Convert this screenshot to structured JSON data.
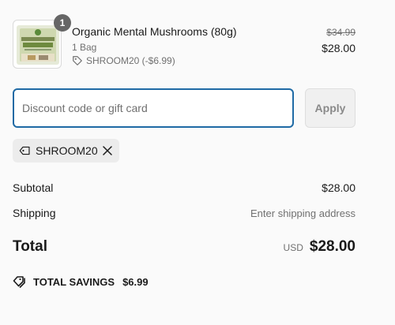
{
  "item": {
    "quantity": "1",
    "name": "Organic Mental Mushrooms (80g)",
    "variant": "1 Bag",
    "discount_label": "SHROOM20 (-$6.99)",
    "original_price": "$34.99",
    "price": "$28.00",
    "image_icon": "product-image-icon"
  },
  "discount": {
    "placeholder": "Discount code or gift card",
    "value": "",
    "apply_label": "Apply"
  },
  "applied_code": {
    "code": "SHROOM20"
  },
  "summary": {
    "subtotal_label": "Subtotal",
    "subtotal_value": "$28.00",
    "shipping_label": "Shipping",
    "shipping_value": "Enter shipping address",
    "total_label": "Total",
    "currency": "USD",
    "total_value": "$28.00",
    "savings_label": "TOTAL SAVINGS",
    "savings_value": "$6.99"
  },
  "colors": {
    "accent": "#1f6aa5",
    "badge": "#666666",
    "muted_text": "#707070"
  }
}
